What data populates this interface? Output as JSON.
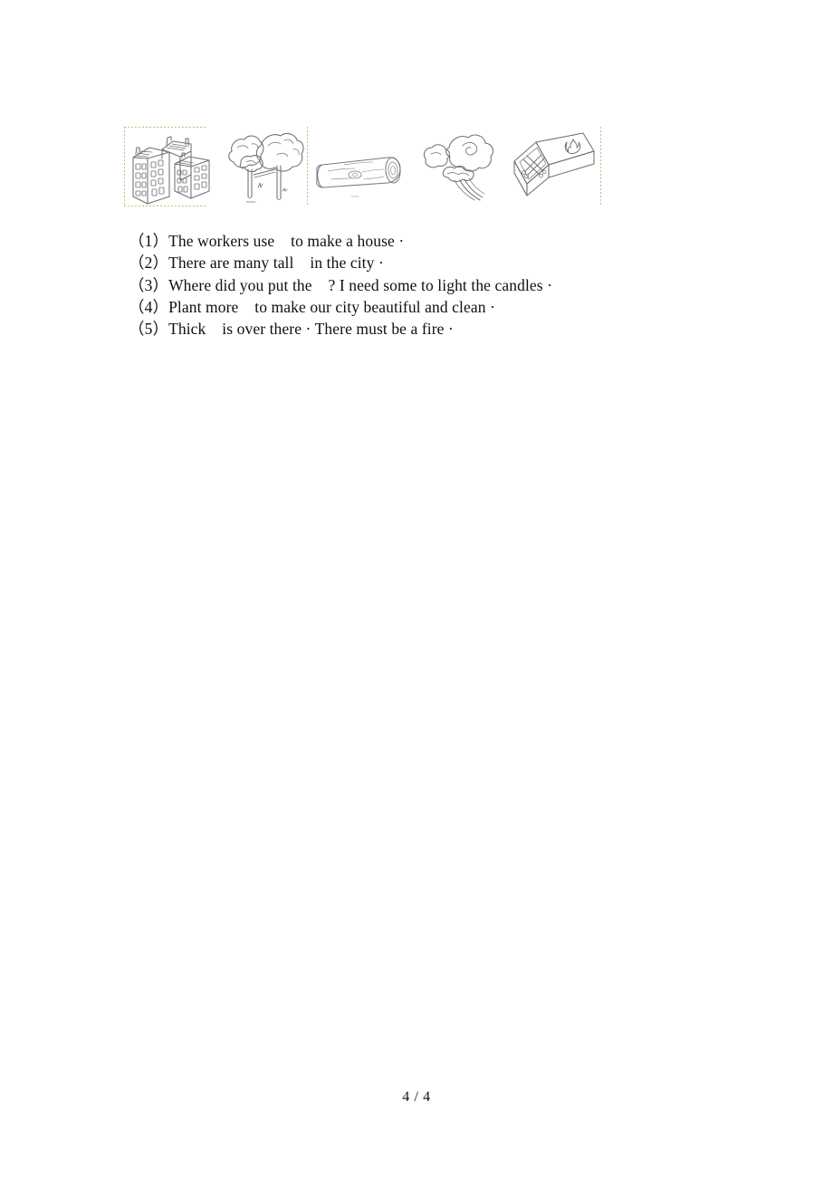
{
  "document": {
    "page_label": "4 / 4"
  },
  "picture_strip": {
    "name": "illustration-row",
    "items": [
      {
        "id": "buildings",
        "icon_name": "buildings-illustration",
        "alt": "tall buildings"
      },
      {
        "id": "trees",
        "icon_name": "trees-illustration",
        "alt": "trees"
      },
      {
        "id": "wood-log",
        "icon_name": "wood-log-illustration",
        "alt": "wood log"
      },
      {
        "id": "smoke",
        "icon_name": "smoke-illustration",
        "alt": "thick smoke"
      },
      {
        "id": "matchbox",
        "icon_name": "matchbox-illustration",
        "alt": "box of matches"
      }
    ]
  },
  "questions": [
    {
      "number": "（1）",
      "text": "The workers use    to make a house ·"
    },
    {
      "number": "（2）",
      "text": "There are many tall    in the city ·"
    },
    {
      "number": "（3）",
      "text": "Where did you put the    ? I need some to light the candles ·"
    },
    {
      "number": "（4）",
      "text": "Plant more    to make our city beautiful and clean ·"
    },
    {
      "number": "（5）",
      "text": "Thick    is over there · There must be a fire ·"
    }
  ],
  "colors": {
    "paper": "#ffffff",
    "ink": "#101010",
    "sketch": "#6b6b6b",
    "guide_line": "#9fbf6a"
  }
}
